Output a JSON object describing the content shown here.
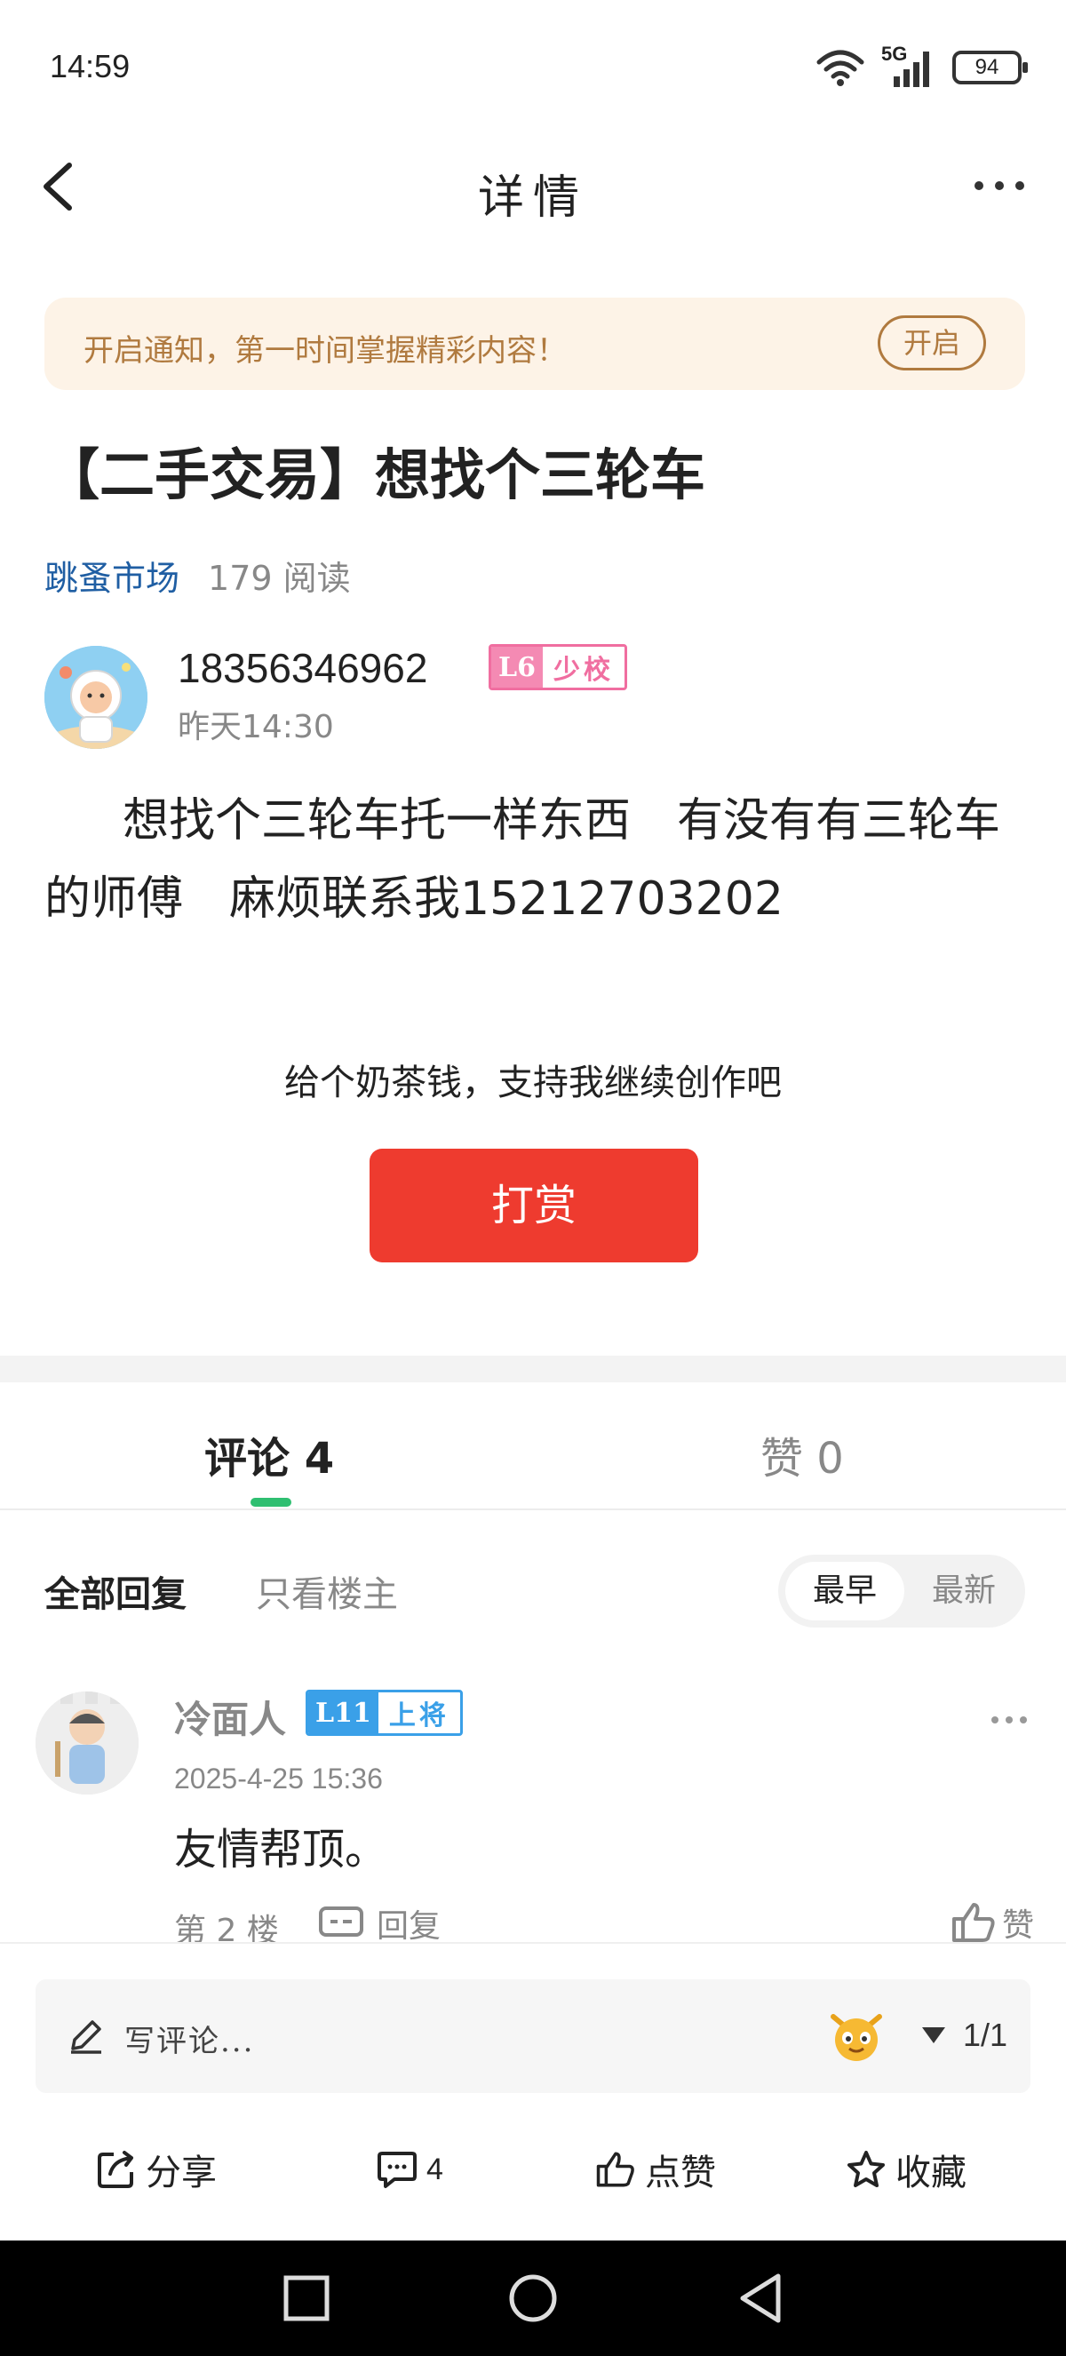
{
  "status_bar": {
    "time": "14:59",
    "network": "5G",
    "battery": "94",
    "icons": [
      "wifi-icon",
      "signal-icon",
      "battery-icon"
    ]
  },
  "nav": {
    "title": "详情",
    "icons": [
      "back-arrow-icon",
      "more-dots-icon"
    ]
  },
  "notify_banner": {
    "text": "开启通知，第一时间掌握精彩内容！",
    "button": "开启"
  },
  "post": {
    "title": "【二手交易】想找个三轮车",
    "category": "跳蚤市场",
    "reads": "179 阅读",
    "author": {
      "name": "18356346962",
      "level": "L6",
      "rank": "少校",
      "time": "昨天14:30"
    },
    "body": "想找个三轮车托一样东西　有没有有三轮车的师傅　麻烦联系我15212703202"
  },
  "tip": {
    "text": "给个奶茶钱，支持我继续创作吧",
    "button": "打赏"
  },
  "tabs": {
    "comments": "评论 4",
    "likes": "赞 0"
  },
  "filter": {
    "all": "全部回复",
    "op_only": "只看楼主",
    "sort_earliest": "最早",
    "sort_latest": "最新"
  },
  "comments": [
    {
      "name": "冷面人",
      "level": "L11",
      "rank": "上将",
      "time": "2025-4-25 15:36",
      "text": "友情帮顶。",
      "floor": "第 2 楼",
      "reply": "回复",
      "like": "赞"
    }
  ],
  "composer": {
    "placeholder": "写评论...",
    "page": "1/1"
  },
  "actions": {
    "share": "分享",
    "comments": "4",
    "like": "点赞",
    "collect": "收藏"
  },
  "colors": {
    "accent_green": "#2fbf71",
    "tip_red": "#ee3b2f",
    "category_blue": "#1f5ea3",
    "banner_bg": "#fdf3e7",
    "banner_text": "#b07a3f"
  }
}
